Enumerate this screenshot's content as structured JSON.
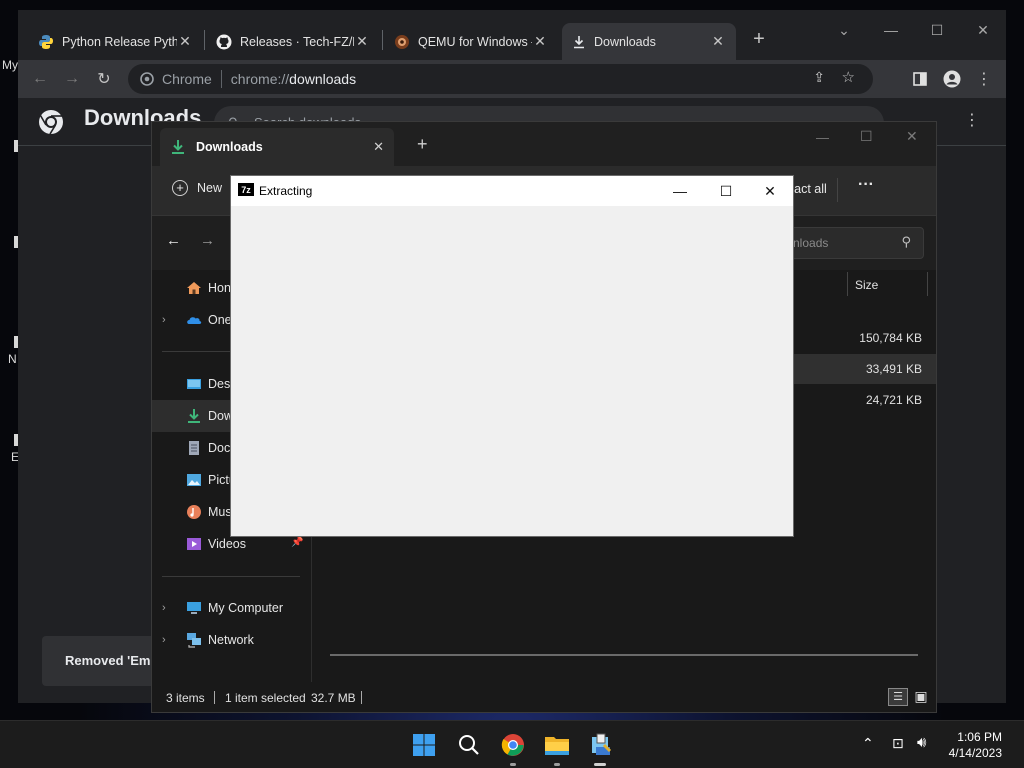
{
  "desktop": {
    "fragments": [
      "My",
      "N",
      "E"
    ]
  },
  "chrome": {
    "tabs": [
      {
        "title": "Python Release Pytho",
        "icon": "python-icon"
      },
      {
        "title": "Releases · Tech-FZ/Em",
        "icon": "github-icon"
      },
      {
        "title": "QEMU for Windows –",
        "icon": "qemu-icon"
      },
      {
        "title": "Downloads",
        "icon": "download-icon"
      }
    ],
    "new_tab": "+",
    "omnibox": {
      "chip": "Chrome",
      "url_scheme": "chrome://",
      "url_path": "downloads"
    },
    "downloads_page": {
      "title": "Downloads",
      "search_placeholder": "Search downloads",
      "toast": "Removed 'Emu"
    }
  },
  "explorer": {
    "tab_title": "Downloads",
    "new_button": "New",
    "extract_all": "ract all",
    "more": "···",
    "search_placeholder": "nloads",
    "column_size": "Size",
    "sizes": [
      "150,784 KB",
      "33,491 KB",
      "24,721 KB"
    ],
    "nav": [
      {
        "label": "Hon",
        "icon": "home-icon",
        "chevron": false
      },
      {
        "label": "One",
        "icon": "onedrive-icon",
        "chevron": true
      },
      {
        "label": "Desk",
        "icon": "desktop-icon",
        "chevron": false
      },
      {
        "label": "Dow",
        "icon": "downloads-icon",
        "chevron": false
      },
      {
        "label": "Doc",
        "icon": "documents-icon",
        "chevron": false
      },
      {
        "label": "Pictu",
        "icon": "pictures-icon",
        "chevron": false
      },
      {
        "label": "Mus",
        "icon": "music-icon",
        "chevron": false
      },
      {
        "label": "Videos",
        "icon": "videos-icon",
        "chevron": false
      },
      {
        "label": "My Computer",
        "icon": "computer-icon",
        "chevron": true
      },
      {
        "label": "Network",
        "icon": "network-icon",
        "chevron": true
      }
    ],
    "status": {
      "items": "3 items",
      "selected": "1 item selected",
      "size": "32.7 MB"
    }
  },
  "dialog": {
    "title": "Extracting",
    "app_icon": "7z"
  },
  "taskbar": {
    "time": "1:06 PM",
    "date": "4/14/2023"
  },
  "colors": {
    "chrome_bg": "#202124",
    "chrome_toolbar": "#35363a",
    "explorer_bg": "#191919",
    "dialog_bg": "#f0f0f0",
    "accent_green": "#3fb67a",
    "accent_blue": "#4c9bf0"
  }
}
